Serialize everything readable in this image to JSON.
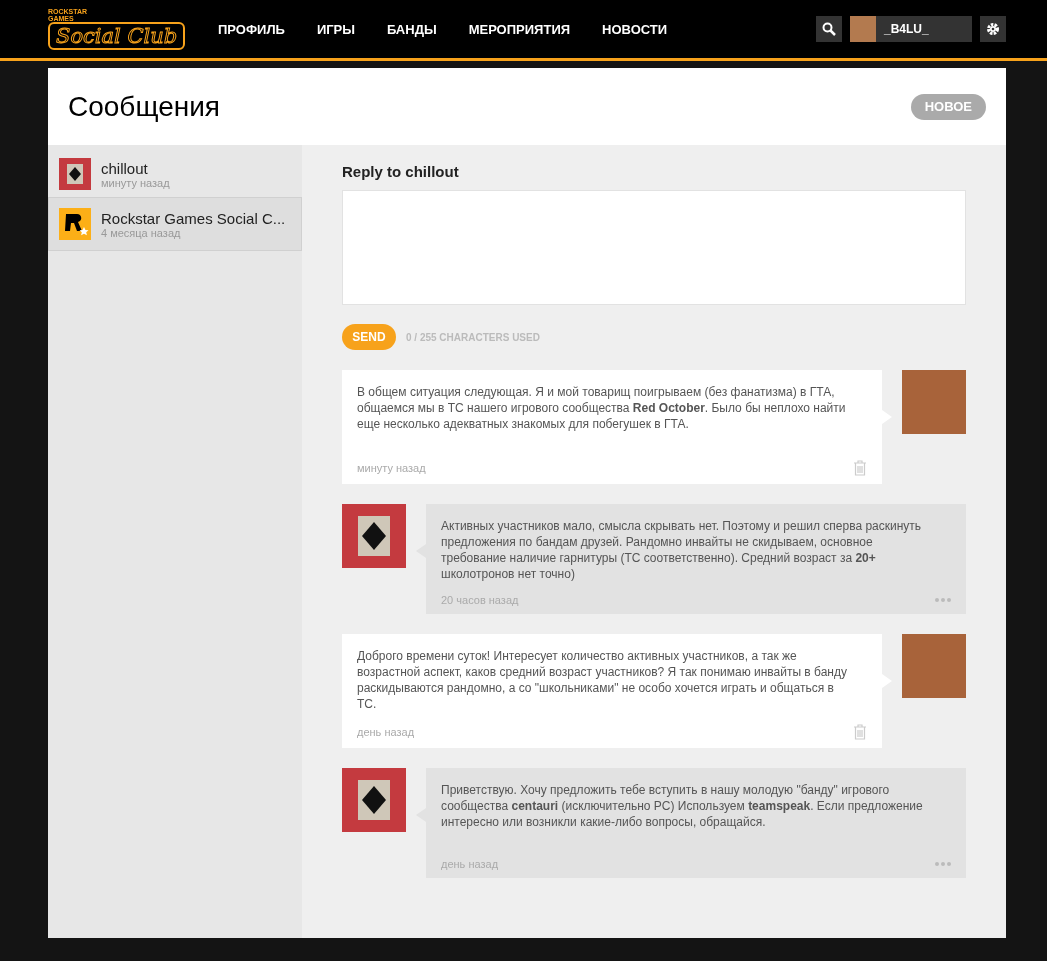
{
  "header": {
    "logo": {
      "top": "ROCKSTAR GAMES",
      "main": "Social Club"
    },
    "nav": [
      {
        "label": "ПРОФИЛЬ",
        "selected": false
      },
      {
        "label": "ИГРЫ",
        "selected": false
      },
      {
        "label": "БАНДЫ",
        "selected": false
      },
      {
        "label": "МЕРОПРИЯТИЯ",
        "selected": false
      },
      {
        "label": "НОВОСТИ",
        "selected": false
      }
    ],
    "username": "_B4LU_"
  },
  "page": {
    "title": "Сообщения",
    "new_button": "НОВОЕ"
  },
  "conversations": [
    {
      "name": "chillout",
      "time": "минуту назад",
      "selected": false,
      "kind": "cards"
    },
    {
      "name": "Rockstar Games Social C...",
      "time": "4 месяца назад",
      "selected": true,
      "kind": "rockstar"
    }
  ],
  "reply": {
    "title": "Reply to chillout",
    "send": "SEND",
    "counter": "0 / 255 CHARACTERS USED"
  },
  "messages": [
    {
      "kind": "own",
      "text": "В общем ситуация следующая. Я и мой товарищ поигрываем (без фанатизма) в ГТА, общаемся мы в ТС нашего игрового сообщества **Red October**. Было бы неплохо найти еще несколько адекватных знакомых для побегушек в ГТА.",
      "time": "минуту назад"
    },
    {
      "kind": "other",
      "text": "Активных участников мало, смысла скрывать нет. Поэтому и решил сперва раскинуть предложения по бандам друзей. Рандомно инвайты не скидываем, основное требование наличие гарнитуры (ТС соответственно). Средний возраст за **20+** школотронов нет точно)",
      "time": "20 часов назад"
    },
    {
      "kind": "own",
      "text": "Доброго времени суток! Интересует количество активных участников, а так же возрастной аспект, каков средний возраст участников? Я так понимаю инвайты в банду раскидываются рандомно, а со \"школьниками\" не особо хочется играть и общаться в ТС.",
      "time": "день назад"
    },
    {
      "kind": "other",
      "text": "Приветствую. Хочу предложить тебе вступить в нашу молодую \"банду\" игрового сообщества **centauri** (исключительно PC) Используем **teamspeak**. Если предложение интересно или возникли какие-либо вопросы, обращайся.",
      "time": "день назад"
    }
  ]
}
